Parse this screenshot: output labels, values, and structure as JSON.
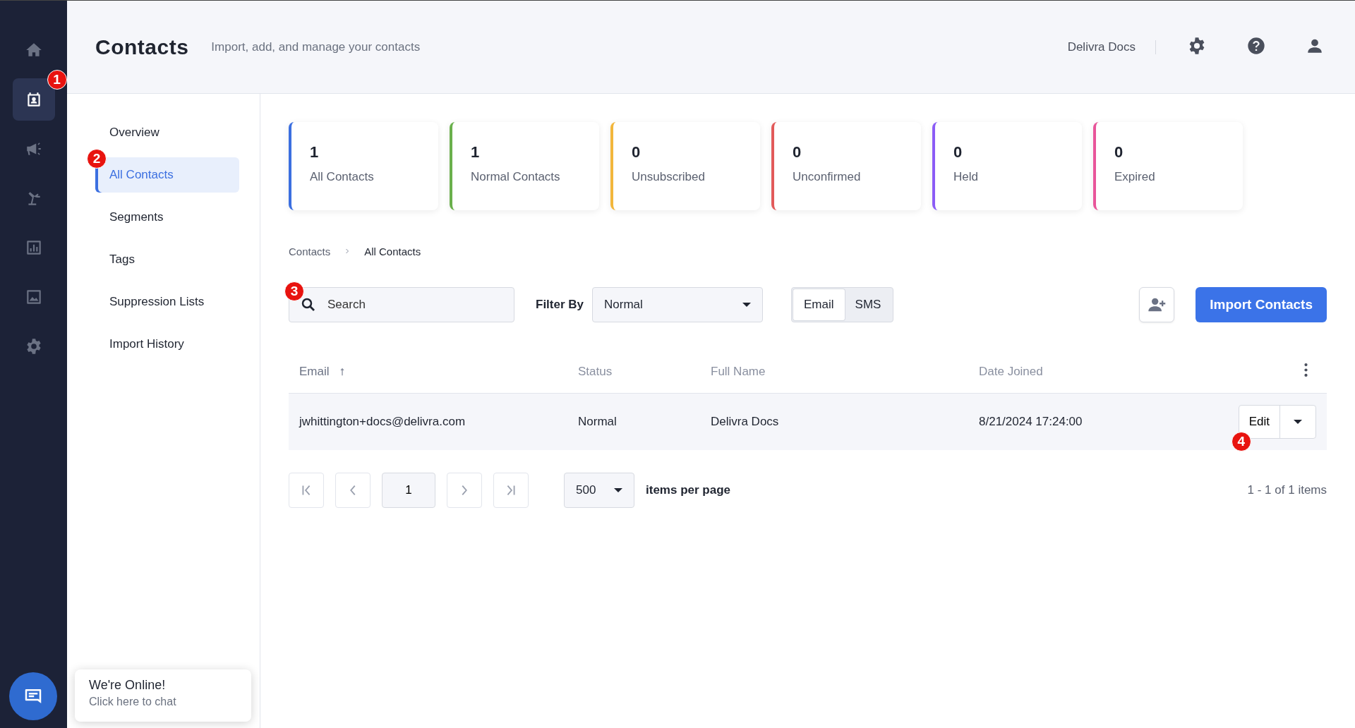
{
  "rail": {
    "items": [
      {
        "selected": false
      },
      {
        "selected": true,
        "callout": "1"
      },
      {
        "selected": false
      },
      {
        "selected": false
      },
      {
        "selected": false
      },
      {
        "selected": false
      },
      {
        "selected": false
      }
    ]
  },
  "header": {
    "title": "Contacts",
    "subtitle": "Import, add, and manage your contacts",
    "account": "Delivra Docs"
  },
  "subnav": {
    "items": [
      {
        "label": "Overview",
        "selected": false
      },
      {
        "label": "All Contacts",
        "selected": true,
        "callout": "2"
      },
      {
        "label": "Segments",
        "selected": false
      },
      {
        "label": "Tags",
        "selected": false
      },
      {
        "label": "Suppression Lists",
        "selected": false
      },
      {
        "label": "Import History",
        "selected": false
      }
    ]
  },
  "stats": [
    {
      "count": "1",
      "label": "All Contacts",
      "color": "#3b6fe0"
    },
    {
      "count": "1",
      "label": "Normal Contacts",
      "color": "#6ab04c"
    },
    {
      "count": "0",
      "label": "Unsubscribed",
      "color": "#f2b63b"
    },
    {
      "count": "0",
      "label": "Unconfirmed",
      "color": "#e25a5a"
    },
    {
      "count": "0",
      "label": "Held",
      "color": "#8b5cf6"
    },
    {
      "count": "0",
      "label": "Expired",
      "color": "#e8559a"
    }
  ],
  "breadcrumb": [
    "Contacts",
    "All Contacts"
  ],
  "toolbar": {
    "search": {
      "placeholder": "Search",
      "callout": "3"
    },
    "filter_label": "Filter By",
    "filter_value": "Normal",
    "channels": [
      {
        "label": "Email",
        "selected": true
      },
      {
        "label": "SMS",
        "selected": false
      }
    ],
    "import_button": "Import Contacts"
  },
  "table": {
    "columns": [
      {
        "label": "Email",
        "sorted": true
      },
      {
        "label": "Status",
        "sorted": false
      },
      {
        "label": "Full Name",
        "sorted": false
      },
      {
        "label": "Date Joined",
        "sorted": false
      }
    ],
    "rows": [
      {
        "cells": [
          "jwhittington+docs@delivra.com",
          "Normal",
          "Delivra Docs",
          "8/21/2024 17:24:00"
        ],
        "action": "Edit",
        "callout": "4"
      }
    ]
  },
  "pagination": {
    "page": "1",
    "page_size": "500",
    "page_size_label": "items per page",
    "summary": "1 - 1 of 1 items"
  },
  "chat": {
    "title": "We're Online!",
    "subtitle": "Click here to chat"
  }
}
